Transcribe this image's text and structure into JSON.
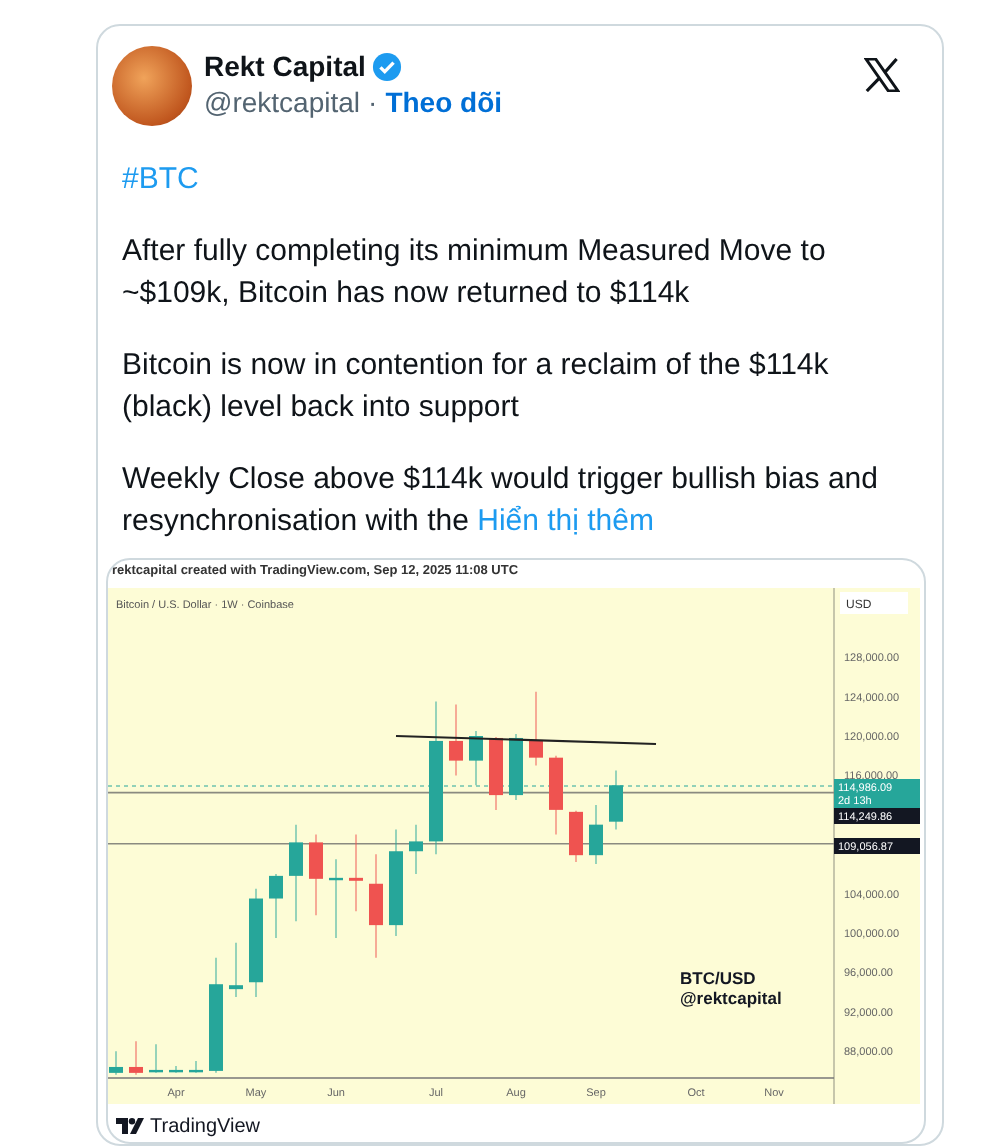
{
  "author": {
    "name": "Rekt Capital",
    "handle": "@rektcapital",
    "separator": "·",
    "follow": "Theo dõi"
  },
  "hashtag": "#BTC",
  "paragraphs": [
    "After fully completing its minimum Measured Move to ~$109k, Bitcoin has now returned to $114k",
    "Bitcoin is now in contention for a reclaim of the $114k (black) level back into support"
  ],
  "last_paragraph": {
    "text": "Weekly Close above $114k would trigger bullish bias and resynchronisation with the",
    "link": "Hiển thị thêm"
  },
  "chart_image": {
    "caption": "rektcapital created with TradingView.com, Sep 12, 2025 11:08 UTC",
    "title": "Bitcoin / U.S. Dollar · 1W · Coinbase",
    "currency": "USD",
    "price_labels": [
      "128,000.00",
      "124,000.00",
      "120,000.00",
      "116,000.00",
      "104,000.00",
      "100,000.00",
      "96,000.00",
      "92,000.00",
      "88,000.00"
    ],
    "price_tags": [
      {
        "kind": "current",
        "text": "114,986.09",
        "sub": "2d 13h"
      },
      {
        "kind": "level",
        "text": "114,249.86"
      },
      {
        "kind": "level",
        "text": "109,056.87"
      }
    ],
    "months": [
      "Apr",
      "May",
      "Jun",
      "Jul",
      "Aug",
      "Sep",
      "Oct",
      "Nov"
    ],
    "chart_label": [
      "BTC/USD",
      "@rektcapital"
    ],
    "footer": "TradingView"
  }
}
